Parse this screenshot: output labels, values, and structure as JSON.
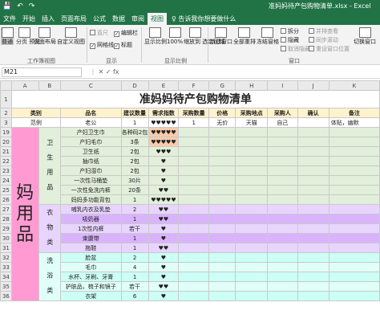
{
  "qat": {
    "save": "💾",
    "undo": "↶",
    "redo": "↷"
  },
  "window_title": "准妈妈待产包购物清单.xlsx - Excel",
  "tabs": [
    "文件",
    "开始",
    "插入",
    "页面布局",
    "公式",
    "数据",
    "审阅",
    "视图"
  ],
  "active_tab": "视图",
  "tell_me": "♀ 告诉我你想要做什么",
  "ribbon": {
    "normal": "普通",
    "page_break": "分页\n预览",
    "page_layout": "页面布局",
    "custom_view": "自定义视图",
    "group_views": "工作簿视图",
    "ruler": "直尺",
    "gridlines": "网格线",
    "formula_bar": "编辑栏",
    "headings": "标题",
    "group_show": "显示",
    "zoom": "显示比例",
    "zoom100": "100%",
    "zoom_sel": "缩放到\n选定区域",
    "group_zoom": "显示比例",
    "new_window": "新建窗口",
    "arrange_all": "全部重排",
    "freeze": "冻结窗格",
    "split": "拆分",
    "hide": "隐藏",
    "unhide": "取消隐藏",
    "side_by_side": "并排查看",
    "sync_scroll": "同步滚动",
    "reset_pos": "重设窗口位置",
    "switch_window": "切换窗口",
    "group_window": "窗口"
  },
  "name_box": "M21",
  "fx_icons": "⋮  ✕  ✓  fx",
  "columns": [
    "A",
    "B",
    "C",
    "D",
    "E",
    "F",
    "G",
    "H",
    "I",
    "J",
    "K"
  ],
  "sheet": {
    "title": "准妈妈待产包购物清单",
    "headers": [
      "类别",
      "品名",
      "建议数量",
      "需求指数",
      "采购数量",
      "价格",
      "采购地点",
      "采购人",
      "确认",
      "备注"
    ],
    "example": {
      "row": "3",
      "cat": "范例",
      "name": "老公",
      "qty": "1",
      "stars": "♥♥♥♥♥",
      "buy": "1",
      "price": "无价",
      "place": "天猫",
      "buyer": "自己",
      "note": "体贴，幽默"
    },
    "big_label": "妈\n用\n品",
    "group1": "卫  生  用  品",
    "group2": "衣  物  类",
    "group3": "洗  浴  类",
    "rows": [
      {
        "r": "19",
        "name": "产妇卫生巾",
        "qty": "各种码2包",
        "stars": "♥♥♥♥♥"
      },
      {
        "r": "20",
        "name": "产妇毛巾",
        "qty": "3条",
        "stars": "♥♥♥♥♥"
      },
      {
        "r": "21",
        "name": "卫生纸",
        "qty": "2包",
        "stars": "♥♥♥"
      },
      {
        "r": "22",
        "name": "抽巾纸",
        "qty": "2包",
        "stars": "♥"
      },
      {
        "r": "23",
        "name": "产妇湿巾",
        "qty": "2包",
        "stars": "♥"
      },
      {
        "r": "24",
        "name": "一次性马桶垫",
        "qty": "30片",
        "stars": "♥"
      },
      {
        "r": "25",
        "name": "一次性免洗内裤",
        "qty": "20条",
        "stars": "♥♥"
      },
      {
        "r": "26",
        "name": "妈妈多功能背包",
        "qty": "1",
        "stars": "♥♥♥♥♥"
      },
      {
        "r": "27",
        "name": "哺乳内衣及乳垫",
        "qty": "2",
        "stars": "♥♥"
      },
      {
        "r": "28",
        "name": "吸奶器",
        "qty": "1",
        "stars": "♥♥"
      },
      {
        "r": "29",
        "name": "1次性内裤",
        "qty": "若干",
        "stars": "♥"
      },
      {
        "r": "30",
        "name": "束腹带",
        "qty": "1",
        "stars": "♥"
      },
      {
        "r": "31",
        "name": "拖鞋",
        "qty": "1",
        "stars": "♥♥"
      },
      {
        "r": "32",
        "name": "脸盆",
        "qty": "2",
        "stars": "♥"
      },
      {
        "r": "33",
        "name": "毛巾",
        "qty": "4",
        "stars": "♥"
      },
      {
        "r": "34",
        "name": "水杯、牙刷、牙膏",
        "qty": "1",
        "stars": "♥"
      },
      {
        "r": "35",
        "name": "护肤品，梳子和镜子",
        "qty": "若干",
        "stars": "♥♥"
      },
      {
        "r": "36",
        "name": "衣架",
        "qty": "6",
        "stars": "♥"
      }
    ]
  }
}
